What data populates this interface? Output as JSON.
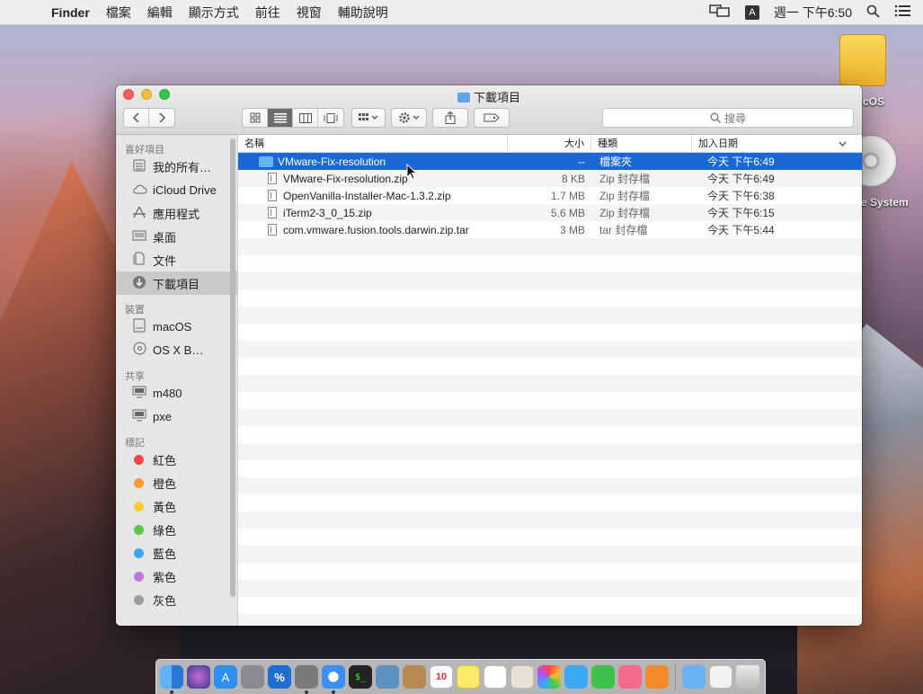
{
  "menubar": {
    "app": "Finder",
    "items": [
      "檔案",
      "編輯",
      "顯示方式",
      "前往",
      "視窗",
      "輔助說明"
    ],
    "input_source": "A",
    "clock": "週一 下午6:50"
  },
  "desktop": {
    "drive_label": "cOS",
    "disc_label": "e System"
  },
  "window": {
    "title": "下載項目",
    "search_placeholder": "搜尋",
    "sidebar": {
      "sections": [
        {
          "heading": "喜好項目",
          "items": [
            "我的所有…",
            "iCloud Drive",
            "應用程式",
            "桌面",
            "文件",
            "下載項目"
          ]
        },
        {
          "heading": "裝置",
          "items": [
            "macOS",
            "OS X B…"
          ]
        },
        {
          "heading": "共享",
          "items": [
            "m480",
            "pxe"
          ]
        },
        {
          "heading": "標記",
          "items": [
            "紅色",
            "橙色",
            "黃色",
            "綠色",
            "藍色",
            "紫色",
            "灰色"
          ]
        }
      ],
      "tag_colors": [
        "#f4454a",
        "#f99b32",
        "#f8cd34",
        "#5cc945",
        "#3ea7f2",
        "#c075d8",
        "#9a9a9a"
      ],
      "selected": "下載項目"
    },
    "columns": {
      "name": "名稱",
      "size": "大小",
      "kind": "種類",
      "date": "加入日期"
    },
    "files": [
      {
        "name": "VMware-Fix-resolution",
        "size": "--",
        "kind": "檔案夾",
        "date": "今天 下午6:49",
        "type": "folder",
        "selected": true
      },
      {
        "name": "VMware-Fix-resolution.zip",
        "size": "8 KB",
        "kind": "Zip 封存檔",
        "date": "今天 下午6:49",
        "type": "file"
      },
      {
        "name": "OpenVanilla-Installer-Mac-1.3.2.zip",
        "size": "1.7 MB",
        "kind": "Zip 封存檔",
        "date": "今天 下午6:38",
        "type": "file"
      },
      {
        "name": "iTerm2-3_0_15.zip",
        "size": "5.6 MB",
        "kind": "Zip 封存檔",
        "date": "今天 下午6:15",
        "type": "file"
      },
      {
        "name": "com.vmware.fusion.tools.darwin.zip.tar",
        "size": "3 MB",
        "kind": "tar 封存檔",
        "date": "今天 下午5:44",
        "type": "file"
      }
    ]
  },
  "dock": {
    "calendar_day": "10",
    "terminal_label": "$_",
    "percent_label": "%"
  }
}
